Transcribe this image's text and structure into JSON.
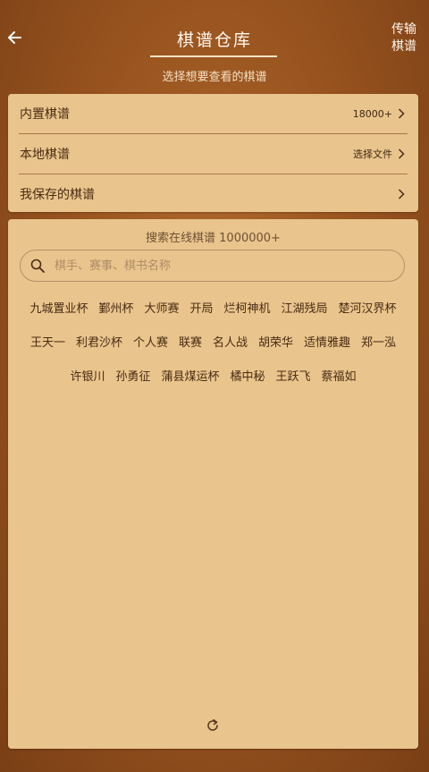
{
  "header": {
    "title": "棋谱仓库",
    "transfer_line1": "传输",
    "transfer_line2": "棋谱",
    "subtitle": "选择想要查看的棋谱",
    "back_icon": "arrow-left-icon"
  },
  "library_list": [
    {
      "label": "内置棋谱",
      "meta": "18000+"
    },
    {
      "label": "本地棋谱",
      "meta": "选择文件"
    },
    {
      "label": "我保存的棋谱",
      "meta": ""
    }
  ],
  "search": {
    "title": "搜索在线棋谱 1000000+",
    "placeholder": "棋手、赛事、棋书名称",
    "icon": "search-icon"
  },
  "tags": {
    "row1": [
      "九城置业杯",
      "鄞州杯",
      "大师赛",
      "开局",
      "烂柯神机",
      "江湖残局",
      "楚河汉界杯"
    ],
    "row2": [
      "王天一",
      "利君沙杯",
      "个人赛",
      "联赛",
      "名人战",
      "胡荣华",
      "适情雅趣",
      "郑一泓"
    ],
    "row3": [
      "许银川",
      "孙勇征",
      "蒲县煤运杯",
      "橘中秘",
      "王跃飞",
      "蔡福如"
    ]
  },
  "colors": {
    "background": "#9a5520",
    "card": "#e9c48c",
    "text": "#4a2c14",
    "title": "#fff8ee"
  },
  "refresh_icon": "refresh-icon"
}
